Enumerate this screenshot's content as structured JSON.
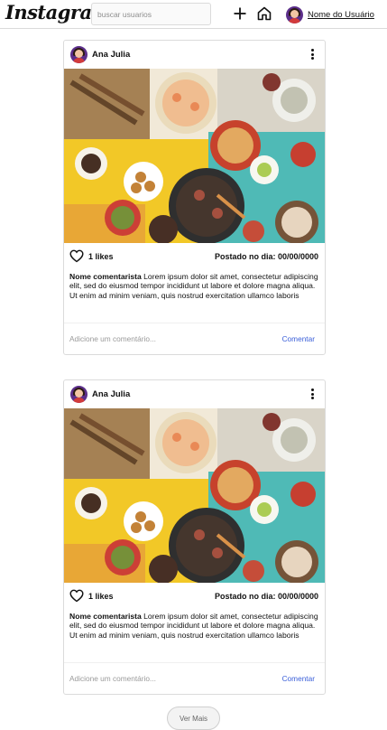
{
  "app": {
    "logo": "Instagram"
  },
  "search": {
    "placeholder": "buscar usuarios"
  },
  "header": {
    "user_name": "Nome do Usuário"
  },
  "posts": [
    {
      "user": "Ana Julia",
      "likes": "1 likes",
      "date": "Postado no dia: 00/00/0000",
      "comment_author": "Nome comentarista",
      "comment_text": " Lorem ipsum dolor sit amet, consectetur adipiscing elit, sed do eiusmod tempor incididunt ut labore et dolore magna aliqua. Ut enim ad minim veniam, quis nostrud exercitation ullamco laboris",
      "comment_placeholder": "Adicione um comentário...",
      "comment_button": "Comentar"
    },
    {
      "user": "Ana Julia",
      "likes": "1 likes",
      "date": "Postado no dia: 00/00/0000",
      "comment_author": "Nome comentarista",
      "comment_text": " Lorem ipsum dolor sit amet, consectetur adipiscing elit, sed do eiusmod tempor incididunt ut labore et dolore magna aliqua. Ut enim ad minim veniam, quis nostrud exercitation ullamco laboris",
      "comment_placeholder": "Adicione um comentário...",
      "comment_button": "Comentar"
    }
  ],
  "load_more": "Ver Mais",
  "icons": {
    "new_post": "plus-icon",
    "home": "home-icon",
    "like": "heart-icon",
    "options": "more-vertical-icon"
  }
}
